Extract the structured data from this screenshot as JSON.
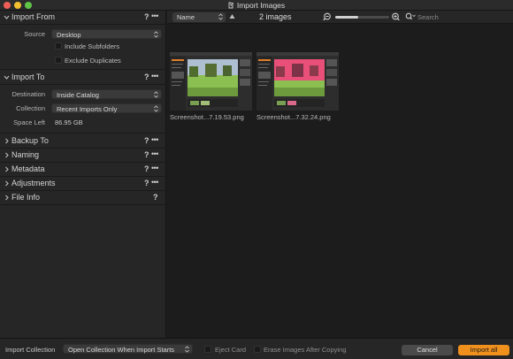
{
  "window": {
    "title": "Import Images"
  },
  "colors": {
    "accent": "#f0901d",
    "close": "#ee5e57",
    "minimize": "#f2bf31",
    "maximize": "#5ec545"
  },
  "left_panel": {
    "import_from": {
      "title": "Import From",
      "source_label": "Source",
      "source_value": "Desktop",
      "include_subfolders": {
        "label": "Include Subfolders",
        "checked": false
      },
      "exclude_duplicates": {
        "label": "Exclude Duplicates",
        "checked": false
      }
    },
    "import_to": {
      "title": "Import To",
      "destination_label": "Destination",
      "destination_value": "Inside Catalog",
      "collection_label": "Collection",
      "collection_value": "Recent Imports Only",
      "space_left_label": "Space Left",
      "space_left_value": "86.95 GB"
    },
    "collapsed_sections": [
      {
        "title": "Backup To"
      },
      {
        "title": "Naming"
      },
      {
        "title": "Metadata"
      },
      {
        "title": "Adjustments"
      },
      {
        "title": "File Info"
      }
    ],
    "help_glyph": "?",
    "more_glyph": "•••"
  },
  "browser": {
    "sort_value": "Name",
    "image_count": "2 images",
    "zoom_level": 0.42,
    "search_placeholder": "Search",
    "thumbnails": [
      {
        "caption": "Screenshot...7.19.53.png"
      },
      {
        "caption": "Screenshot...7.32.24.png"
      }
    ]
  },
  "bottom_bar": {
    "import_collection_label": "Import Collection",
    "import_collection_value": "Open Collection When Import Starts",
    "eject_card": {
      "label": "Eject Card",
      "checked": false
    },
    "erase_images": {
      "label": "Erase Images After Copying",
      "checked": false
    },
    "cancel_label": "Cancel",
    "import_label": "Import all"
  }
}
